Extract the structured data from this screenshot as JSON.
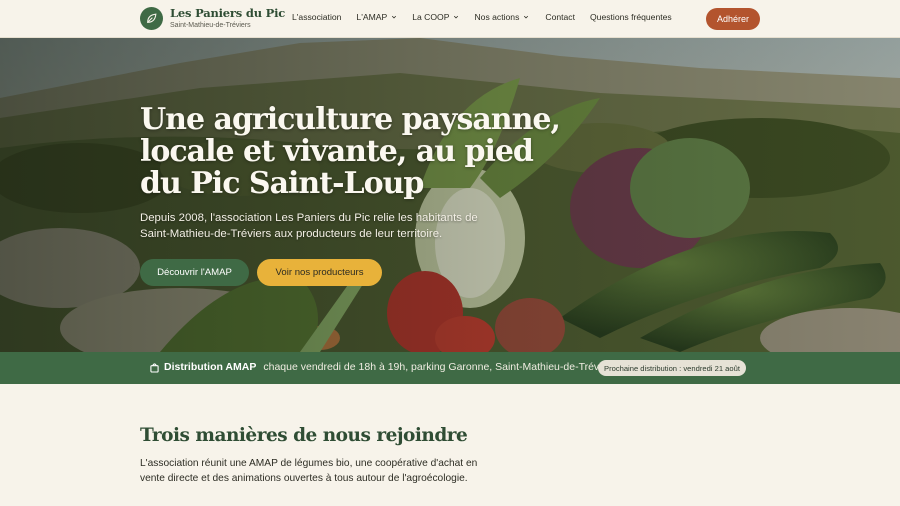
{
  "header": {
    "logo_title": "Les Paniers du Pic",
    "logo_subtitle": "Saint-Mathieu-de-Tréviers",
    "nav": [
      {
        "label": "L'association",
        "dropdown": false
      },
      {
        "label": "L'AMAP",
        "dropdown": true
      },
      {
        "label": "La COOP",
        "dropdown": true
      },
      {
        "label": "Nos actions",
        "dropdown": true
      },
      {
        "label": "Contact",
        "dropdown": false
      },
      {
        "label": "Questions fréquentes",
        "dropdown": false
      }
    ],
    "cta_label": "Adhérer"
  },
  "hero": {
    "title": "Une agriculture paysanne, locale et vivante, au pied du Pic Saint-Loup",
    "text": "Depuis 2008, l'association Les Paniers du Pic relie les habitants de Saint-Mathieu-de-Tréviers aux producteurs de leur territoire.",
    "primary_button": "Découvrir l'AMAP",
    "secondary_button": "Voir nos producteurs"
  },
  "distribution": {
    "label": "Distribution AMAP",
    "text": "chaque vendredi de 18h à 19h, parking Garonne, Saint-Mathieu-de-Tréviers",
    "next": "Prochaine distribution : vendredi 21 août"
  },
  "section": {
    "title": "Trois manières de nous rejoindre",
    "text": "L'association réunit une AMAP de légumes bio, une coopérative d'achat en vente directe et des animations ouvertes à tous autour de l'agroécologie."
  },
  "colors": {
    "green": "#3f6a45",
    "terracotta": "#b3542e",
    "yellow": "#e8b23a",
    "cream": "#f7f3ea"
  },
  "icons": [
    "leaf-icon",
    "chevron-down-icon",
    "basket-icon"
  ]
}
